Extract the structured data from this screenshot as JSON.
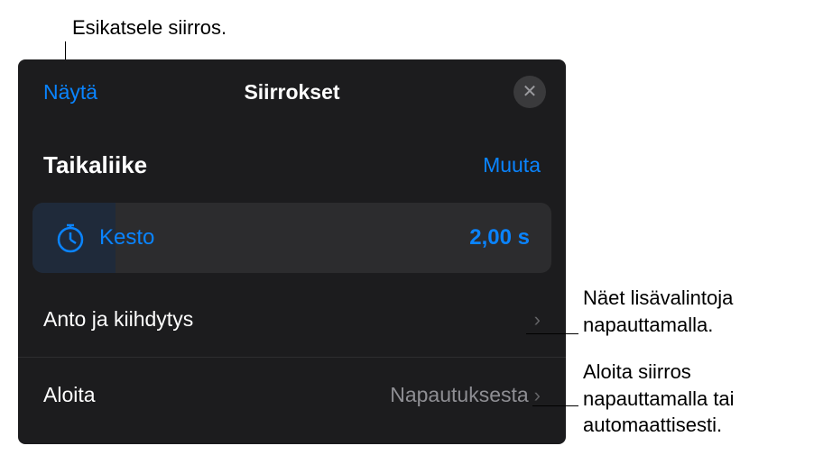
{
  "callouts": {
    "top": "Esikatsele siirros.",
    "right1_line1": "Näet lisävalintoja",
    "right1_line2": "napauttamalla.",
    "right2_line1": "Aloita siirros",
    "right2_line2": "napauttamalla tai",
    "right2_line3": "automaattisesti."
  },
  "header": {
    "preview": "Näytä",
    "title": "Siirrokset"
  },
  "section": {
    "title": "Taikaliike",
    "change": "Muuta"
  },
  "duration": {
    "label": "Kesto",
    "value": "2,00 s"
  },
  "rows": {
    "delivery": {
      "label": "Anto ja kiihdytys"
    },
    "start": {
      "label": "Aloita",
      "value": "Napautuksesta"
    }
  }
}
